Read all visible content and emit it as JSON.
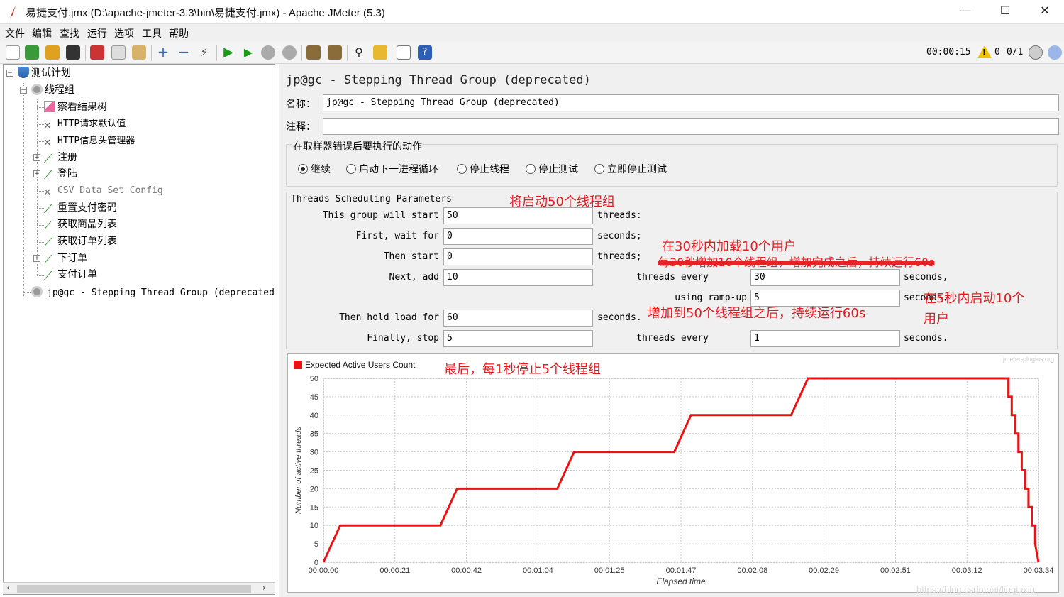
{
  "window": {
    "title": "易捷支付.jmx (D:\\apache-jmeter-3.3\\bin\\易捷支付.jmx) - Apache JMeter (5.3)",
    "minimize": "—",
    "maximize": "☐",
    "close": "✕"
  },
  "menu": [
    "文件",
    "编辑",
    "查找",
    "运行",
    "选项",
    "工具",
    "帮助"
  ],
  "toolbar": {
    "elapsed": "00:00:15",
    "warnings": "0",
    "threads": "0/1"
  },
  "tree": [
    {
      "label": "测试计划",
      "icon": "test-plan-icon"
    },
    {
      "label": "线程组",
      "icon": "gear-icon"
    },
    {
      "label": "察看结果树",
      "icon": "chart-icon"
    },
    {
      "label": "HTTP请求默认值",
      "icon": "wrench-icon"
    },
    {
      "label": "HTTP信息头管理器",
      "icon": "wrench-icon"
    },
    {
      "label": "注册",
      "icon": "pipette-icon"
    },
    {
      "label": "登陆",
      "icon": "pipette-icon"
    },
    {
      "label": "CSV Data Set Config",
      "icon": "wrench-icon"
    },
    {
      "label": "重置支付密码",
      "icon": "pipette-icon"
    },
    {
      "label": "获取商品列表",
      "icon": "pipette-icon"
    },
    {
      "label": "获取订单列表",
      "icon": "pipette-icon"
    },
    {
      "label": "下订单",
      "icon": "pipette-icon"
    },
    {
      "label": "支付订单",
      "icon": "pipette-icon"
    },
    {
      "label": "jp@gc - Stepping Thread Group (deprecated)",
      "icon": "gear-icon"
    }
  ],
  "panel": {
    "title": "jp@gc - Stepping Thread Group (deprecated)",
    "name_label": "名称：",
    "name_value": "jp@gc - Stepping Thread Group (deprecated)",
    "comment_label": "注释：",
    "comment_value": "",
    "error_group_label": "在取样器错误后要执行的动作",
    "error_actions": [
      "继续",
      "启动下一进程循环",
      "停止线程",
      "停止测试",
      "立即停止测试"
    ],
    "sched_label": "Threads Scheduling Parameters",
    "params": {
      "start_label": "This group will start",
      "start_value": "50",
      "start_unit": "threads:",
      "wait_label": "First, wait for",
      "wait_value": "0",
      "wait_unit": "seconds;",
      "then_start_label": "Then start",
      "then_start_value": "0",
      "then_start_unit": "threads;",
      "next_add_label": "Next, add",
      "next_add_value": "10",
      "every_label": "threads every",
      "every_value": "30",
      "every_unit": "seconds,",
      "rampup_label": "using ramp-up",
      "rampup_value": "5",
      "rampup_unit": "seconds.",
      "hold_label": "Then hold load for",
      "hold_value": "60",
      "hold_unit": "seconds.",
      "stop_label": "Finally, stop",
      "stop_value": "5",
      "stop_every_label": "threads every",
      "stop_every_value": "1",
      "stop_every_unit": "seconds."
    }
  },
  "annotations": {
    "start50": "将启动50个线程组",
    "load30": "在30秒内加载10个用户",
    "strike": "每30秒增加10个线程组，增加完成之后，持续运行60s",
    "hold60": "增加到50个线程组之后，持续运行60s",
    "ramp5_line1": "在5秒内启动10个",
    "ramp5_line2": "用户",
    "final": "最后，每1秒停止5个线程组"
  },
  "chart_data": {
    "type": "line",
    "title": "",
    "legend": [
      "Expected Active Users Count"
    ],
    "legend_placement": "top-left",
    "watermark": "jmeter-plugins.org",
    "xlabel": "Elapsed time",
    "ylabel": "Number of active threads",
    "ylim": [
      0,
      50
    ],
    "yticks": [
      0,
      5,
      10,
      15,
      20,
      25,
      30,
      35,
      40,
      45,
      50
    ],
    "xlim_seconds": [
      0,
      214
    ],
    "xtick_labels": [
      "00:00:00",
      "00:00:21",
      "00:00:42",
      "00:01:04",
      "00:01:25",
      "00:01:47",
      "00:02:08",
      "00:02:29",
      "00:02:51",
      "00:03:12",
      "00:03:34"
    ],
    "grid": true,
    "color": "#ee1111",
    "series": [
      {
        "name": "Expected Active Users Count",
        "x": [
          0,
          5,
          35,
          40,
          70,
          75,
          105,
          110,
          140,
          145,
          205,
          205,
          206,
          206,
          207,
          207,
          208,
          208,
          209,
          209,
          210,
          210,
          211,
          211,
          212,
          212,
          213,
          213,
          214
        ],
        "y": [
          0,
          10,
          10,
          20,
          20,
          30,
          30,
          40,
          40,
          50,
          50,
          45,
          45,
          40,
          40,
          35,
          35,
          30,
          30,
          25,
          25,
          20,
          20,
          15,
          15,
          10,
          10,
          5,
          0
        ]
      }
    ]
  },
  "footer_watermark": "https://blog.csdn.net/liuqiuxiu"
}
